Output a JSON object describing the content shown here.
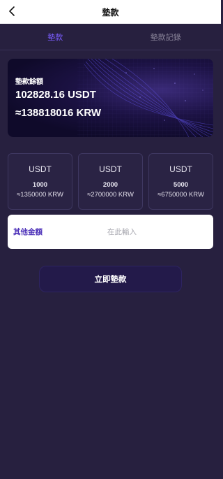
{
  "header": {
    "title": "墊款",
    "back_icon": "chevron-left-icon"
  },
  "tabs": [
    {
      "label": "墊款",
      "active": true
    },
    {
      "label": "墊款記錄",
      "active": false
    }
  ],
  "balance": {
    "label": "墊款餘額",
    "usdt": "102828.16 USDT",
    "krw": "≈138818016 KRW"
  },
  "options": [
    {
      "currency": "USDT",
      "amount": "1000",
      "krw": "≈1350000 KRW"
    },
    {
      "currency": "USDT",
      "amount": "2000",
      "krw": "≈2700000 KRW"
    },
    {
      "currency": "USDT",
      "amount": "5000",
      "krw": "≈6750000 KRW"
    }
  ],
  "other_amount": {
    "label": "其他金額",
    "placeholder": "在此輸入",
    "value": ""
  },
  "submit": {
    "label": "立即墊款"
  },
  "colors": {
    "background": "#27203f",
    "accent": "#7a5cff",
    "card": "#2a2344",
    "button": "#231a4a"
  }
}
